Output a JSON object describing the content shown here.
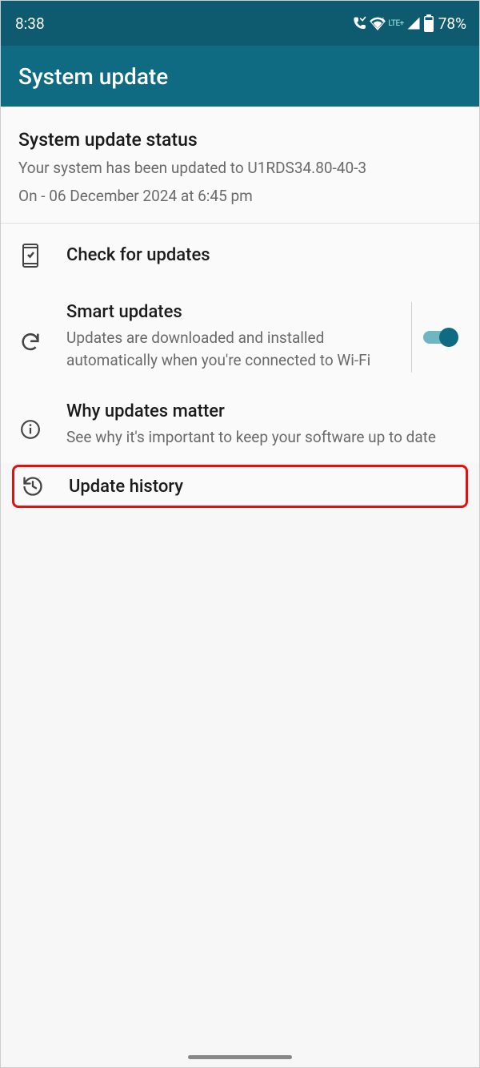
{
  "statusbar": {
    "time": "8:38",
    "lte_label": "LTE+",
    "battery_pct": "78%"
  },
  "header": {
    "title": "System update"
  },
  "status_section": {
    "title": "System update status",
    "message": "Your system has been updated to U1RDS34.80-40-3",
    "date": "On - 06 December 2024 at 6:45 pm"
  },
  "items": {
    "check_updates": {
      "title": "Check for updates"
    },
    "smart_updates": {
      "title": "Smart updates",
      "desc": "Updates are downloaded and installed automatically when you're connected to Wi-Fi",
      "enabled": true
    },
    "why_matter": {
      "title": "Why updates matter",
      "desc": "See why it's important to keep your software up to date"
    },
    "update_history": {
      "title": "Update history"
    }
  }
}
